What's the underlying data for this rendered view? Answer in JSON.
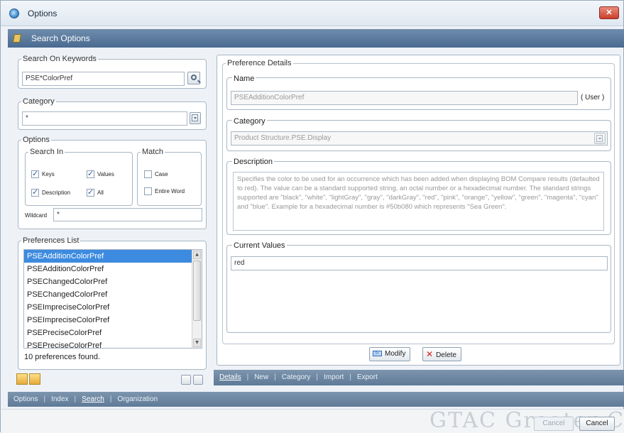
{
  "window": {
    "title": "Options",
    "close_label": "✕"
  },
  "header": {
    "title": "Search Options"
  },
  "search": {
    "legend": "Search On Keywords",
    "value": "PSE*ColorPref"
  },
  "category_filter": {
    "legend": "Category",
    "value": "*"
  },
  "options": {
    "legend": "Options",
    "search_in": {
      "legend": "Search In",
      "keys": {
        "label": "Keys",
        "checked": true
      },
      "values": {
        "label": "Values",
        "checked": true
      },
      "description": {
        "label": "Description",
        "checked": true
      },
      "all": {
        "label": "All",
        "checked": true
      }
    },
    "match": {
      "legend": "Match",
      "case": {
        "label": "Case",
        "checked": false
      },
      "entire_word": {
        "label": "Entire Word",
        "checked": false
      }
    },
    "wildcard": {
      "label": "Wildcard",
      "value": "*"
    }
  },
  "preferences_list": {
    "legend": "Preferences List",
    "items": [
      "PSEAdditionColorPref",
      "PSEAdditionColorPref",
      "PSEChangedColorPref",
      "PSEChangedColorPref",
      "PSEImpreciseColorPref",
      "PSEImpreciseColorPref",
      "PSEPreciseColorPref",
      "PSEPreciseColorPref"
    ],
    "selected_index": 0,
    "found_text": "10 preferences found."
  },
  "preference_details": {
    "legend": "Preference Details",
    "name": {
      "legend": "Name",
      "value": "PSEAdditionColorPref",
      "scope": "( User )"
    },
    "category": {
      "legend": "Category",
      "value": "Product Structure.PSE.Display"
    },
    "description": {
      "legend": "Description",
      "text": "Specifies the color to be used for an occurrence which has been added when displaying BOM Compare results (defaulted to red). The value can be a standard supported string, an octal number or a hexadecimal number. The standard strings supported are \"black\", \"white\", \"lightGray\", \"gray\", \"darkGray\", \"red\", \"pink\", \"orange\", \"yellow\", \"green\", \"magenta\", \"cyan\" and \"blue\". Example for a hexadecimal number is #50b080 which represents \"Sea Green\"."
    },
    "current_values": {
      "legend": "Current Values",
      "value": "red"
    }
  },
  "actions": {
    "modify": "Modify",
    "modify_icon": "0+",
    "delete": "Delete"
  },
  "right_tabs": [
    "Details",
    "New",
    "Category",
    "Import",
    "Export"
  ],
  "bottom_tabs": [
    "Options",
    "Index",
    "Search",
    "Organization"
  ],
  "footer": {
    "ghost_button": "Cancel",
    "cancel": "Cancel",
    "watermark": "GTAC Greater C"
  }
}
